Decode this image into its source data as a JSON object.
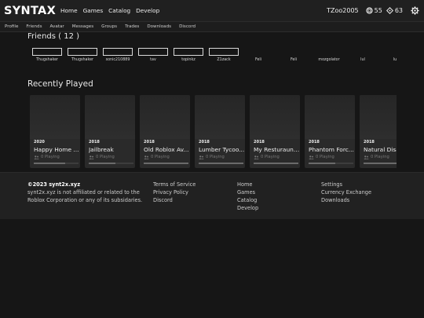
{
  "header": {
    "logo": "SYNTAX",
    "nav": [
      "Home",
      "Games",
      "Catalog",
      "Develop"
    ],
    "username": "TZoo2005",
    "robux": "55",
    "tickets": "63"
  },
  "subnav": [
    "Profile",
    "Friends",
    "Avatar",
    "Messages",
    "Groups",
    "Trades",
    "Downloads",
    "Discord"
  ],
  "friends": {
    "title": "Friends ( 12 )",
    "items": [
      {
        "name": "Thugshaker",
        "has_avatar": true
      },
      {
        "name": "Thugshaker",
        "has_avatar": true
      },
      {
        "name": "sonic210889",
        "has_avatar": true
      },
      {
        "name": "tav",
        "has_avatar": true
      },
      {
        "name": "topinkz",
        "has_avatar": true
      },
      {
        "name": "Z1zack",
        "has_avatar": true
      },
      {
        "name": "Feli",
        "has_avatar": false
      },
      {
        "name": "Feli",
        "has_avatar": false
      },
      {
        "name": "mozgolator",
        "has_avatar": false
      },
      {
        "name": "lul",
        "has_avatar": false
      },
      {
        "name": "lu",
        "has_avatar": false
      }
    ]
  },
  "recently_played": {
    "title": "Recently Played",
    "games": [
      {
        "year": "2020",
        "name": "Happy Home ...",
        "playing": "0 Playing",
        "rating": 0.7
      },
      {
        "year": "2018",
        "name": "Jailbreak",
        "playing": "0 Playing",
        "rating": 0.6
      },
      {
        "year": "2018",
        "name": "Old Roblox Av...",
        "playing": "0 Playing",
        "rating": 1.0
      },
      {
        "year": "2018",
        "name": "Lumber Tycoo...",
        "playing": "0 Playing",
        "rating": 1.0
      },
      {
        "year": "2018",
        "name": "My Resturaunt...",
        "playing": "0 Playing",
        "rating": 1.0
      },
      {
        "year": "2018",
        "name": "Phantom Forc...",
        "playing": "0 Playing",
        "rating": 0.6
      },
      {
        "year": "2018",
        "name": "Natural Disas",
        "playing": "0 Playing",
        "rating": 1.0
      }
    ]
  },
  "footer": {
    "copyright": "©2023 synt2x.xyz",
    "disclaimer1": "synt2x.xyz is not affiliated or related to the",
    "disclaimer2": "Roblox Corporation or any of its subsidaries.",
    "col2": [
      "Terms of Service",
      "Privacy Policy",
      "Discord"
    ],
    "col3": [
      "Home",
      "Games",
      "Catalog",
      "Develop"
    ],
    "col4": [
      "Settings",
      "Currency Exchange",
      "Downloads"
    ]
  }
}
